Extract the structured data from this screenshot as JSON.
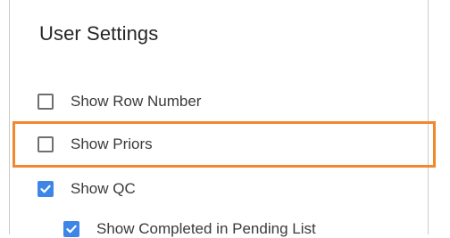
{
  "panel": {
    "title": "User Settings"
  },
  "settings": [
    {
      "label": "Show Row Number",
      "checked": false
    },
    {
      "label": "Show Priors",
      "checked": false,
      "highlighted": true
    },
    {
      "label": "Show QC",
      "checked": true
    },
    {
      "label": "Show Completed in Pending List",
      "checked": true,
      "indented": true
    }
  ],
  "colors": {
    "checkbox_checked": "#3d86e8",
    "highlight_border": "#f0892e"
  },
  "icons": {
    "checkmark": "check-icon"
  }
}
